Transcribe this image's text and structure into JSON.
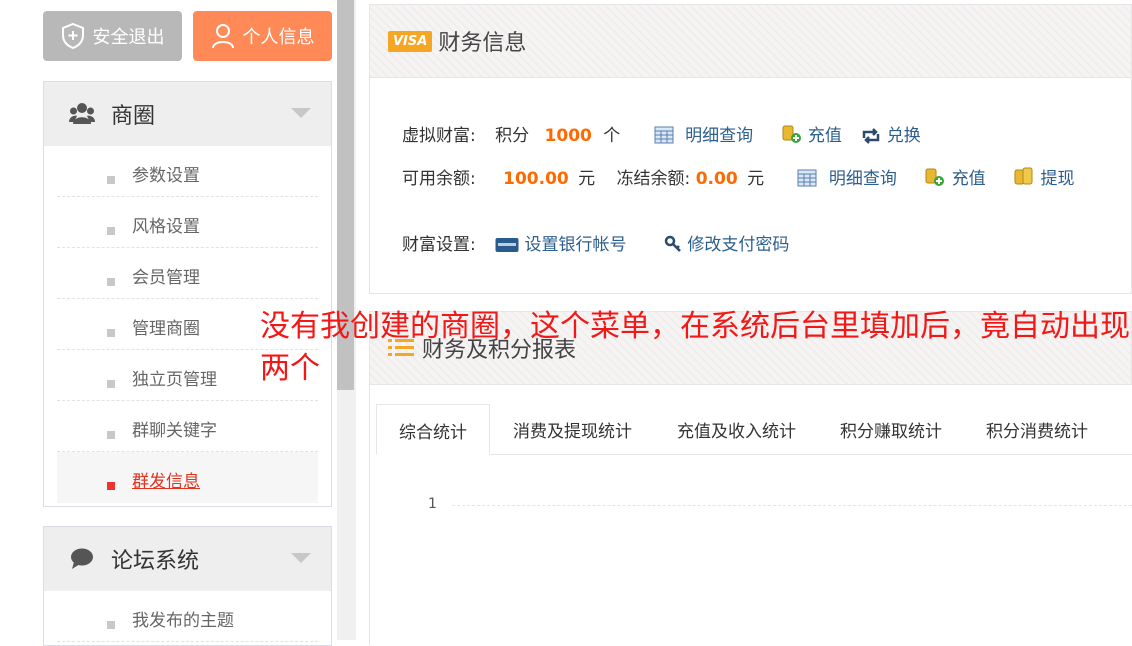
{
  "top_buttons": {
    "logout": "安全退出",
    "profile": "个人信息"
  },
  "sidebar": {
    "commerce": {
      "title": "商圈",
      "items": [
        {
          "label": "参数设置"
        },
        {
          "label": "风格设置"
        },
        {
          "label": "会员管理"
        },
        {
          "label": "管理商圈"
        },
        {
          "label": "独立页管理"
        },
        {
          "label": "群聊关键字"
        },
        {
          "label": "群发信息"
        }
      ]
    },
    "forum": {
      "title": "论坛系统",
      "items": [
        {
          "label": "我发布的主题"
        }
      ]
    }
  },
  "finance": {
    "badge": "VISA",
    "title": "财务信息",
    "virtual_label": "虚拟财富:",
    "points_label": "积分",
    "points_value": "1000",
    "points_unit": "个",
    "detail_query": "明细查询",
    "recharge": "充值",
    "exchange": "兑换",
    "balance_label": "可用余额:",
    "balance_value": "100.00",
    "yuan": "元",
    "frozen_label": "冻结余额:",
    "frozen_value": "0.00",
    "withdraw": "提现",
    "settings_label": "财富设置:",
    "bank_account": "设置银行帐号",
    "change_pwd": "修改支付密码"
  },
  "report": {
    "title": "财务及积分报表",
    "tabs": [
      "综合统计",
      "消费及提现统计",
      "充值及收入统计",
      "积分赚取统计",
      "积分消费统计"
    ],
    "axis_tick": "1"
  },
  "annotation": "没有我创建的商圈，这个菜单，在系统后台里填加后，竟自动出现两个",
  "colors": {
    "accent_orange": "#ff8a57",
    "value_orange": "#ff6a00",
    "link_blue": "#2c5e8e",
    "annotation_red": "#f21818"
  }
}
